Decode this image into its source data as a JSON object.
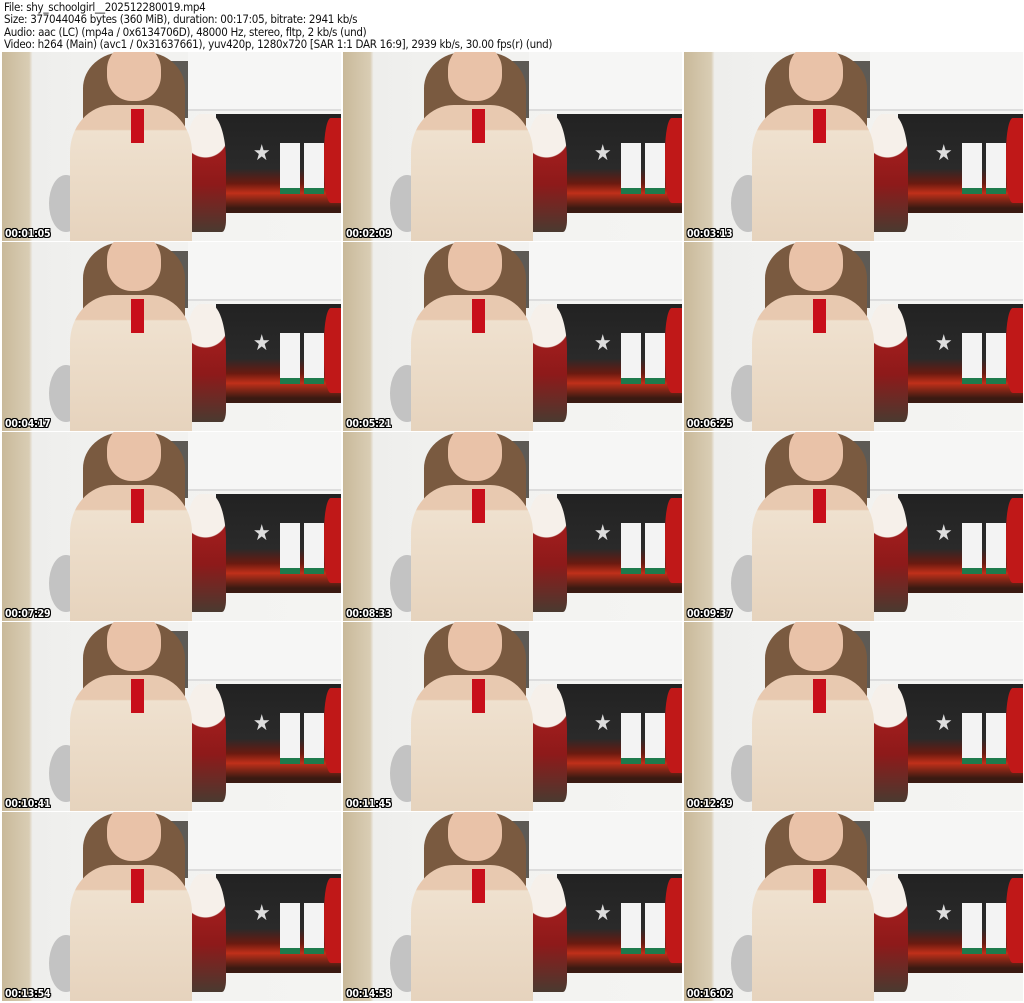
{
  "header": {
    "file": "File: shy_schoolgirl__202512280019.mp4",
    "size": "Size: 377044046 bytes (360 MiB), duration: 00:17:05, bitrate: 2941 kb/s",
    "audio": "Audio: aac (LC) (mp4a / 0x6134706D), 48000 Hz, stereo, fltp, 2 kb/s (und)",
    "video": "Video: h264 (Main) (avc1 / 0x31637661), yuv420p, 1280x720 [SAR 1:1 DAR 16:9], 2939 kb/s, 30.00 fps(r) (und)"
  },
  "thumbnails": [
    {
      "timestamp": "00:01:05"
    },
    {
      "timestamp": "00:02:09"
    },
    {
      "timestamp": "00:03:13"
    },
    {
      "timestamp": "00:04:17"
    },
    {
      "timestamp": "00:05:21"
    },
    {
      "timestamp": "00:06:25"
    },
    {
      "timestamp": "00:07:29"
    },
    {
      "timestamp": "00:08:33"
    },
    {
      "timestamp": "00:09:37"
    },
    {
      "timestamp": "00:10:41"
    },
    {
      "timestamp": "00:11:45"
    },
    {
      "timestamp": "00:12:49"
    },
    {
      "timestamp": "00:13:54"
    },
    {
      "timestamp": "00:14:58"
    },
    {
      "timestamp": "00:16:02"
    }
  ]
}
